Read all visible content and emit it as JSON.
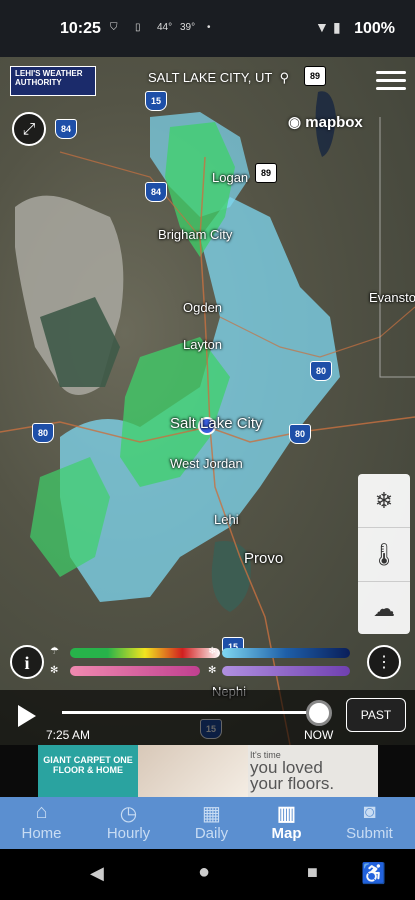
{
  "status_bar": {
    "time": "10:25",
    "temp1": "44°",
    "temp2": "39°",
    "battery": "100%"
  },
  "app": {
    "logo_text": "LEHI'S WEATHER AUTHORITY",
    "search_placeholder": "SALT LAKE CITY, UT",
    "attribution": "mapbox",
    "icons": [
      "expand-icon",
      "search-icon",
      "hamburger-menu-icon",
      "info-icon",
      "more-options-icon"
    ]
  },
  "map": {
    "cities": [
      "Logan",
      "Brigham City",
      "Ogden",
      "Layton",
      "Salt Lake City",
      "West Jordan",
      "Lehi",
      "Provo",
      "Evanston",
      "Nephi"
    ],
    "shields": [
      "15",
      "84",
      "89",
      "84",
      "89",
      "80",
      "80",
      "80",
      "15",
      "15"
    ]
  },
  "layers": {
    "icons": [
      "precipitation-icon",
      "thermometer-icon",
      "cloud-icon"
    ]
  },
  "legend": {
    "rain_colors": [
      "#27b34a",
      "#f2e41f",
      "#d11f1f",
      "#ffffff"
    ],
    "snow_colors": [
      "#7fd8f2",
      "#1e5fa8",
      "#0a1e5a"
    ],
    "mix_colors": [
      "#f08ab0",
      "#c04090"
    ],
    "ice_colors": [
      "#b090e0",
      "#7040b0"
    ]
  },
  "timeline": {
    "start_time": "7:25 AM",
    "end_label": "NOW",
    "past_button": "PAST",
    "progress": 0.95
  },
  "ad": {
    "brand": "GIANT CARPET ONE FLOOR & HOME",
    "line1": "It's time",
    "line2": "you loved",
    "line3": "your floors."
  },
  "tabs": [
    {
      "label": "Home",
      "icon": "home-icon"
    },
    {
      "label": "Hourly",
      "icon": "clock-icon"
    },
    {
      "label": "Daily",
      "icon": "calendar-icon"
    },
    {
      "label": "Map",
      "icon": "map-icon",
      "active": true
    },
    {
      "label": "Submit",
      "icon": "camera-icon"
    }
  ]
}
